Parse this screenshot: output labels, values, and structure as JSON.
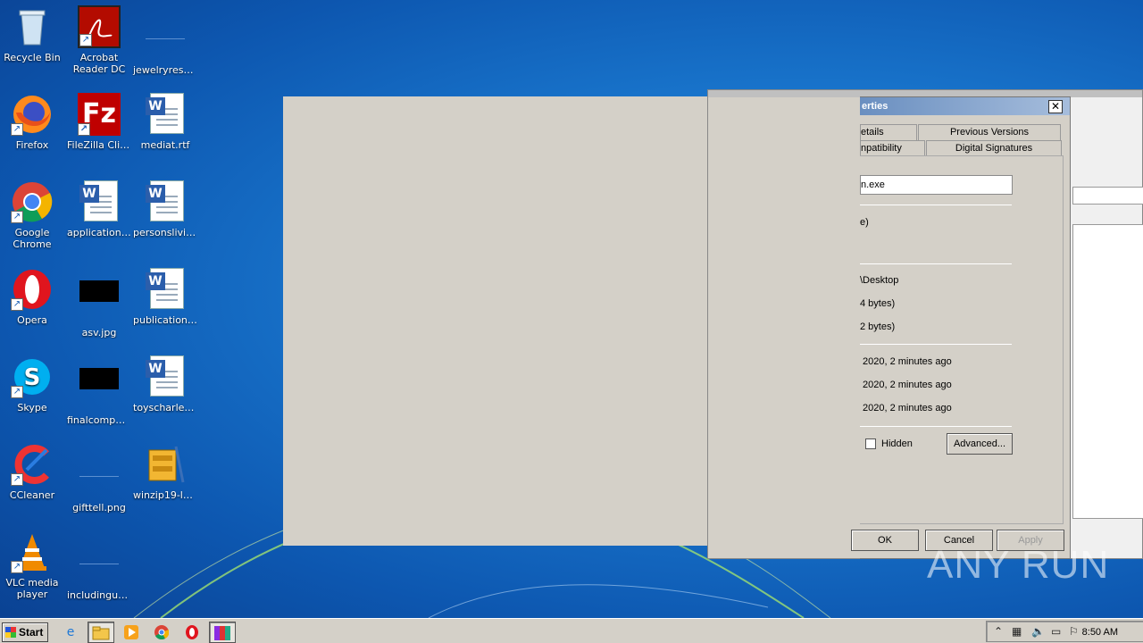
{
  "desktop_icons": [
    {
      "label": "Recycle Bin"
    },
    {
      "label": "Acrobat Reader DC"
    },
    {
      "label": "jewelryresul..."
    },
    {
      "label": "Firefox"
    },
    {
      "label": "FileZilla Client"
    },
    {
      "label": "mediat.rtf"
    },
    {
      "label": "Google Chrome"
    },
    {
      "label": "applications..."
    },
    {
      "label": "personslivin..."
    },
    {
      "label": "Opera"
    },
    {
      "label": "asv.jpg"
    },
    {
      "label": "publicationc..."
    },
    {
      "label": "Skype"
    },
    {
      "label": "finalcomput..."
    },
    {
      "label": "toyscharles.rtf"
    },
    {
      "label": "CCleaner"
    },
    {
      "label": "gifttell.png"
    },
    {
      "label": "winzip19-lan..."
    },
    {
      "label": "VLC media player"
    },
    {
      "label": "includingus..."
    }
  ],
  "dialog": {
    "title": "erties",
    "tabs": [
      "etails",
      "Previous Versions",
      "npatibility",
      "Digital Signatures"
    ],
    "name_value": "n.exe",
    "type_value": "e)",
    "location_value": "\\Desktop",
    "size_value": "4 bytes)",
    "size_on_disk_value": "2 bytes)",
    "created_value": "2020, 2 minutes ago",
    "modified_value": "2020, 2 minutes ago",
    "accessed_value": "2020, 2 minutes ago",
    "hidden_label": "Hidden",
    "advanced_label": "Advanced...",
    "ok_label": "OK",
    "cancel_label": "Cancel",
    "apply_label": "Apply",
    "close_glyph": "✕"
  },
  "watermark": "ANY RUN",
  "taskbar": {
    "start_label": "Start",
    "clock": "8:50 AM",
    "tray_expand": "⌃"
  }
}
